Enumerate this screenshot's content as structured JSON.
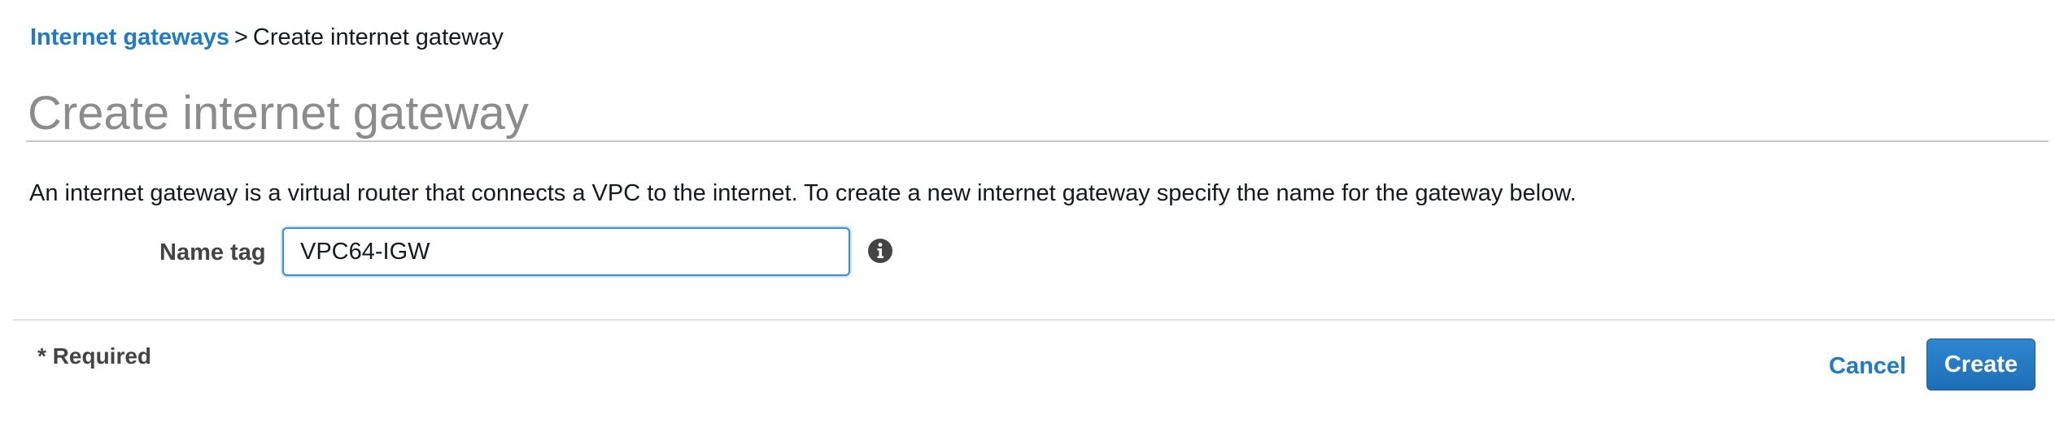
{
  "breadcrumb": {
    "link_label": "Internet gateways",
    "separator": ">",
    "current": "Create internet gateway"
  },
  "page": {
    "title": "Create internet gateway",
    "description": "An internet gateway is a virtual router that connects a VPC to the internet. To create a new internet gateway specify the name for the gateway below."
  },
  "form": {
    "name_tag_label": "Name tag",
    "name_tag_value": "VPC64-IGW",
    "info_icon": "info-icon"
  },
  "footer": {
    "required_note": "* Required",
    "cancel_label": "Cancel",
    "create_label": "Create"
  },
  "colors": {
    "link": "#1f7bc9",
    "title_gray": "#8c8c8c",
    "input_focus_border": "#3b8fd6",
    "primary_button": "#1c6fb6"
  }
}
